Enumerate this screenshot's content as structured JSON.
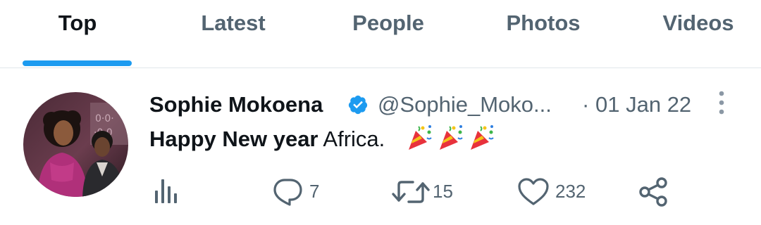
{
  "tabs": [
    {
      "label": "Top",
      "active": true
    },
    {
      "label": "Latest",
      "active": false
    },
    {
      "label": "People",
      "active": false
    },
    {
      "label": "Photos",
      "active": false
    },
    {
      "label": "Videos",
      "active": false
    }
  ],
  "tweet": {
    "author_name": "Sophie Mokoena",
    "verified": true,
    "handle": "@Sophie_Moko...",
    "separator": "·",
    "date": "01 Jan 22",
    "text_bold": "Happy New year",
    "text_rest": " Africa.",
    "emoji": [
      "party-popper",
      "party-popper",
      "party-popper"
    ],
    "actions": {
      "analytics_icon": "bar-chart-icon",
      "reply_count": "7",
      "retweet_count": "15",
      "like_count": "232",
      "share_icon": "share-icon"
    }
  },
  "colors": {
    "accent": "#1d9bf0",
    "text_primary": "#0f1419",
    "text_secondary": "#536471"
  }
}
